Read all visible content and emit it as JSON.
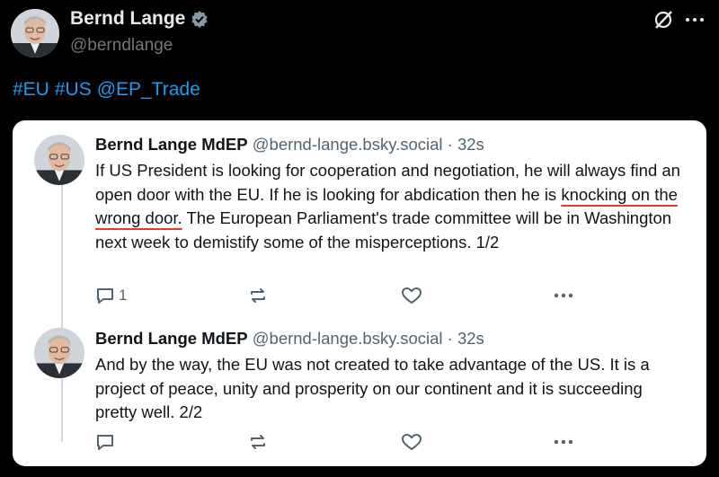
{
  "header": {
    "name": "Bernd Lange",
    "handle": "@berndlange"
  },
  "tags": {
    "eu": "#EU",
    "us": "#US",
    "mention": "@EP_Trade"
  },
  "posts": [
    {
      "author": "Bernd Lange MdEP",
      "handle": "@bernd-lange.bsky.social",
      "sep": "·",
      "time": "32s",
      "text_a": "If US President is looking for cooperation and negotiation, he will always find an open door with the EU. If he is looking for abdication then he is ",
      "text_b": "knocking on the wrong door.",
      "text_c": " The European Parliament's trade committee will be in Washington next week to demistify some of the misperceptions. 1/2",
      "reply_count": "1"
    },
    {
      "author": "Bernd Lange MdEP",
      "handle": "@bernd-lange.bsky.social",
      "sep": "·",
      "time": "32s",
      "text": "And by the way, the EU was not created to take advantage of the US. It is a project of peace, unity and prosperity on our continent and it is succeeding pretty well. 2/2",
      "reply_count": ""
    }
  ],
  "colors": {
    "link": "#1d9bf0",
    "verified": "#829aab",
    "underline": "#e23b2e",
    "muted": "#536471"
  },
  "icons": [
    "verified-badge-icon",
    "grok-icon",
    "more-icon",
    "reply-icon",
    "repost-icon",
    "like-icon",
    "ellipsis-icon"
  ]
}
